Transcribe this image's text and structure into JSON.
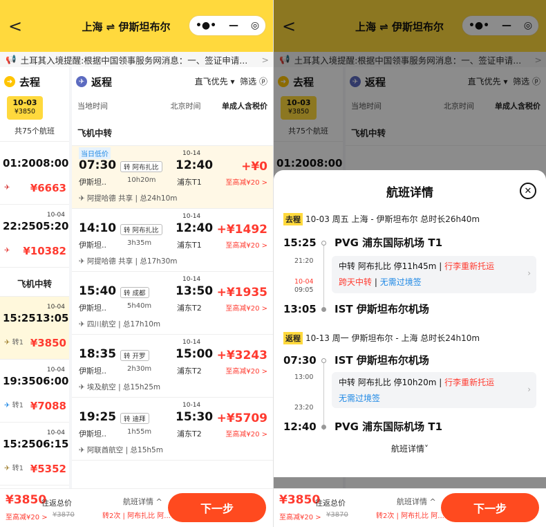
{
  "header": {
    "title": "上海 ⇌ 伊斯坦布尔",
    "back_label": "<",
    "capsule_dots": "•●•",
    "capsule_minus": "—",
    "capsule_target": "◎"
  },
  "notice": {
    "text": "土耳其入境提醒:根据中国领事服务网消息：一、签证申请...",
    "arrow": ">"
  },
  "outbound": {
    "label": "去程",
    "date": "10-03",
    "date_price": "¥3850",
    "count": "共75个航班",
    "rows": [
      {
        "dep": "01:20",
        "arr": "08:00",
        "next": "",
        "logo": "✈",
        "stops": "",
        "price": "¥6663"
      },
      {
        "dep": "22:25",
        "arr": "05:20",
        "next": "10-04",
        "logo": "✈",
        "stops": "",
        "price": "¥10382"
      }
    ],
    "transfer_section": "飞机中转",
    "transfer_rows": [
      {
        "dep": "15:25",
        "arr": "13:05",
        "next": "10-04",
        "logo": "✈",
        "stops": "转1",
        "price": "¥3850"
      },
      {
        "dep": "19:35",
        "arr": "06:00",
        "next": "10-04",
        "logo": "✈",
        "stops": "转1",
        "price": "¥7088"
      },
      {
        "dep": "15:25",
        "arr": "06:15",
        "next": "10-04",
        "logo": "✈",
        "stops": "转1",
        "price": "¥5352"
      }
    ]
  },
  "return": {
    "label": "返程",
    "sort": "直飞优先",
    "filter": "筛选",
    "col_local": "当地时间",
    "col_bj": "北京时间",
    "col_price": "单成人含税价",
    "section": "飞机中转",
    "flights": [
      {
        "low_tag": "当日低价",
        "dep": "07:30",
        "via": "转 阿布扎比",
        "arr": "12:40",
        "next": "10-14",
        "ap1": "伊斯坦..",
        "dur": "10h20m",
        "ap2": "浦东T1",
        "price": "+¥0",
        "reduce": "至高减¥20 >",
        "airline": "阿提哈德",
        "share": "共享",
        "total": "总24h10m"
      },
      {
        "low_tag": "",
        "dep": "14:10",
        "via": "转 阿布扎比",
        "arr": "12:40",
        "next": "10-14",
        "ap1": "伊斯坦..",
        "dur": "3h35m",
        "ap2": "浦东T1",
        "price": "+¥1492",
        "reduce": "至高减¥20 >",
        "airline": "阿提哈德",
        "share": "共享",
        "total": "总17h30m"
      },
      {
        "low_tag": "",
        "dep": "15:40",
        "via": "转 成都",
        "arr": "13:50",
        "next": "10-14",
        "ap1": "伊斯坦..",
        "dur": "5h40m",
        "ap2": "浦东T2",
        "price": "+¥1935",
        "reduce": "至高减¥20 >",
        "airline": "四川航空",
        "share": "",
        "total": "总17h10m"
      },
      {
        "low_tag": "",
        "dep": "18:35",
        "via": "转 开罗",
        "arr": "15:00",
        "next": "10-14",
        "ap1": "伊斯坦..",
        "dur": "2h30m",
        "ap2": "浦东T2",
        "price": "+¥3243",
        "reduce": "至高减¥20 >",
        "airline": "埃及航空",
        "share": "",
        "total": "总15h25m"
      },
      {
        "low_tag": "",
        "dep": "19:25",
        "via": "转 迪拜",
        "arr": "15:30",
        "next": "10-14",
        "ap1": "伊斯坦..",
        "dur": "1h55m",
        "ap2": "浦东T2",
        "price": "+¥5709",
        "reduce": "至高减¥20 >",
        "airline": "阿联酋航空",
        "share": "",
        "total": "总15h5m"
      }
    ]
  },
  "bottom": {
    "price": "¥3850",
    "price_label": "往返总价",
    "reduce": "至高减¥20 >",
    "strike": "¥3870",
    "detail": "航班详情 ^",
    "sub": "转2次 | 阿布扎比 阿...",
    "next": "下一步"
  },
  "sheet": {
    "title": "航班详情",
    "close": "✕",
    "outbound": {
      "tag": "去程",
      "head": "10-03 周五 上海 - 伊斯坦布尔 总时长26h40m",
      "t1": "15:25",
      "ap1": "PVG 浦东国际机场 T1",
      "s1": "21:20",
      "s2a": "10-04",
      "s2b": "09:05",
      "transfer1": "中转 阿布扎比 停11h45m",
      "transfer1b": "行李重新托运",
      "transfer2": "跨天中转",
      "transfer2b": "无需过境签",
      "t2": "13:05",
      "ap2": "IST 伊斯坦布尔机场"
    },
    "return": {
      "tag": "返程",
      "head": "10-13 周一 伊斯坦布尔 - 上海 总时长24h10m",
      "t1": "07:30",
      "ap1": "IST 伊斯坦布尔机场",
      "s1": "13:00",
      "s2": "23:20",
      "transfer1": "中转 阿布扎比 停10h20m",
      "transfer1b": "行李重新托运",
      "transfer2b": "无需过境签",
      "t2": "12:40",
      "ap2": "PVG 浦东国际机场 T1"
    },
    "more": "航班详情˅"
  },
  "colors": {
    "brand_yellow": "#ffd93d",
    "price_red": "#ff3a2f",
    "next_orange": "#ff4a1f",
    "blue": "#1e88e5"
  }
}
